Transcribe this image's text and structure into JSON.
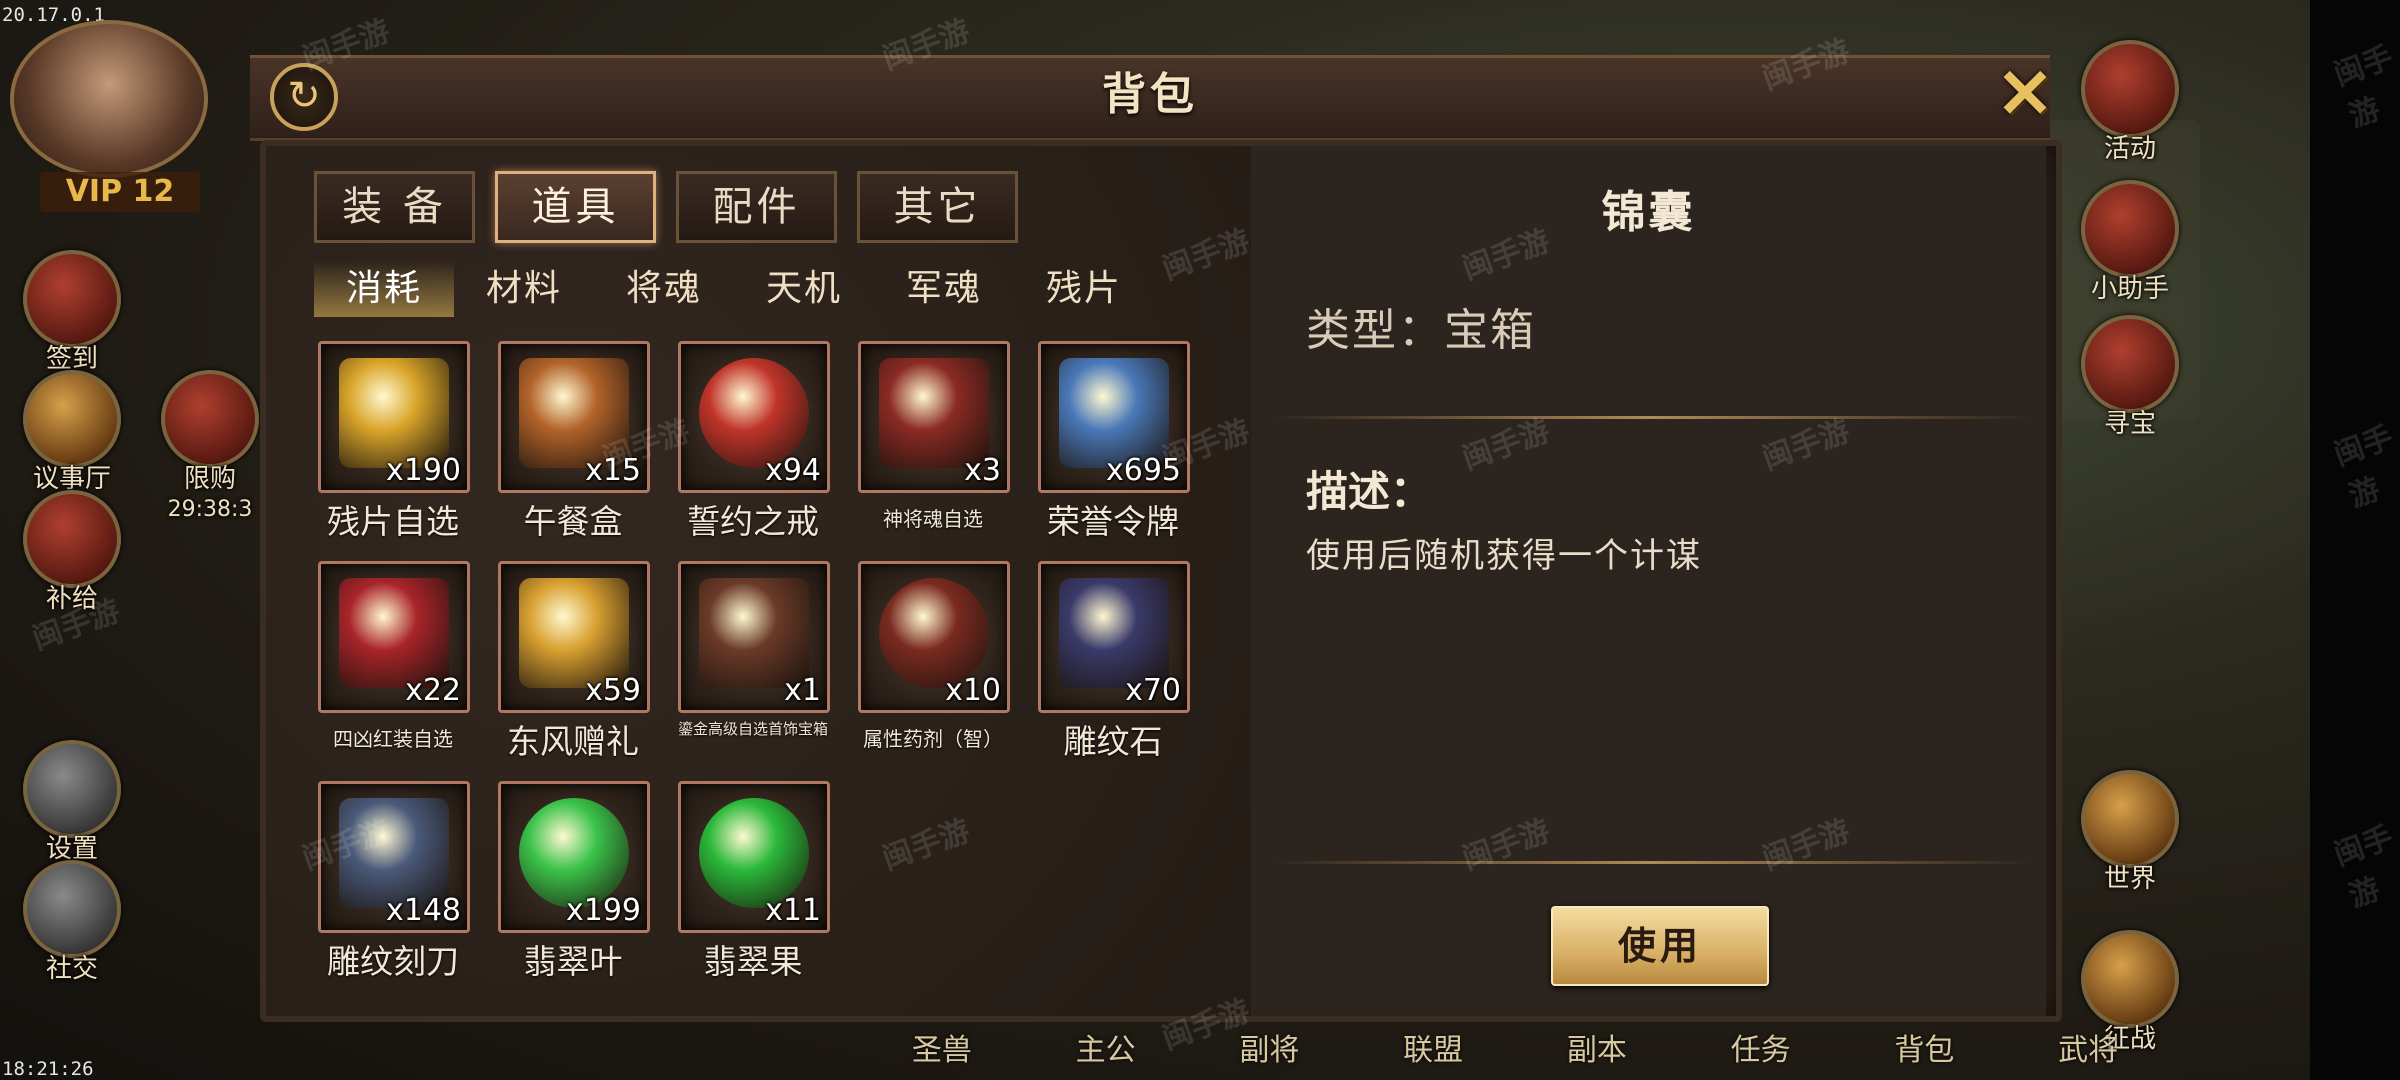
{
  "system": {
    "version": "20.17.0.1",
    "clock": "18:21:26"
  },
  "hud": {
    "vip": "VIP 12",
    "left": [
      {
        "label": "签到",
        "name": "hud-checkin"
      },
      {
        "label": "议事厅",
        "name": "hud-council"
      },
      {
        "label": "补给",
        "name": "hud-supply"
      },
      {
        "label": "设置",
        "name": "hud-settings"
      },
      {
        "label": "社交",
        "name": "hud-social"
      }
    ],
    "limited": {
      "label": "限购",
      "timer": "29:38:3"
    },
    "right": [
      {
        "label": "活动",
        "name": "hud-events"
      },
      {
        "label": "小助手",
        "name": "hud-assistant"
      },
      {
        "label": "寻宝",
        "name": "hud-treasure"
      },
      {
        "label": "世界",
        "name": "hud-world"
      },
      {
        "label": "征战",
        "name": "hud-campaign"
      }
    ],
    "bottom_nav": [
      "圣兽",
      "主公",
      "副将",
      "联盟",
      "副本",
      "任务",
      "背包",
      "武将"
    ]
  },
  "dialog": {
    "title": "背包",
    "tabs": [
      "装 备",
      "道具",
      "配件",
      "其它"
    ],
    "active_tab": 1,
    "subtabs": [
      "消耗",
      "材料",
      "将魂",
      "天机",
      "军魂",
      "残片"
    ],
    "active_subtab": 0,
    "items": [
      {
        "name": "残片自选",
        "count": "x190",
        "icon": "golden-chest-icon",
        "color": "#d9a52a"
      },
      {
        "name": "午餐盒",
        "count": "x15",
        "icon": "lunch-box-icon",
        "color": "#b2632a"
      },
      {
        "name": "誓约之戒",
        "count": "x94",
        "icon": "ring-icon",
        "color": "#c0342a"
      },
      {
        "name": "神将魂自选",
        "count": "x3",
        "icon": "red-box-icon",
        "color": "#8a2a24"
      },
      {
        "name": "荣誉令牌",
        "count": "x695",
        "icon": "honor-token-icon",
        "color": "#4a78b8"
      },
      {
        "name": "四凶红装自选",
        "count": "x22",
        "icon": "red-chest-icon",
        "color": "#a8242a"
      },
      {
        "name": "东风赠礼",
        "count": "x59",
        "icon": "gift-chest-icon",
        "color": "#d8a030"
      },
      {
        "name": "鎏金高级自选首饰宝箱",
        "count": "x1",
        "icon": "jewelry-chest-icon",
        "color": "#6a3a28"
      },
      {
        "name": "属性药剂（智）",
        "count": "x10",
        "icon": "potion-icon",
        "color": "#7a2a20"
      },
      {
        "name": "雕纹石",
        "count": "x70",
        "icon": "carved-stone-icon",
        "color": "#3a3a6a"
      },
      {
        "name": "雕纹刻刀",
        "count": "x148",
        "icon": "carving-knife-icon",
        "color": "#4a5a7a"
      },
      {
        "name": "翡翠叶",
        "count": "x199",
        "icon": "jade-leaf-icon",
        "color": "#3ac24a"
      },
      {
        "name": "翡翠果",
        "count": "x11",
        "icon": "jade-fruit-icon",
        "color": "#2ab83a"
      }
    ],
    "detail": {
      "title": "锦囊",
      "type": "类型：宝箱",
      "desc_label": "描述：",
      "desc": "使用后随机获得一个计谋",
      "use_label": "使用"
    }
  },
  "watermark": "闽手游"
}
